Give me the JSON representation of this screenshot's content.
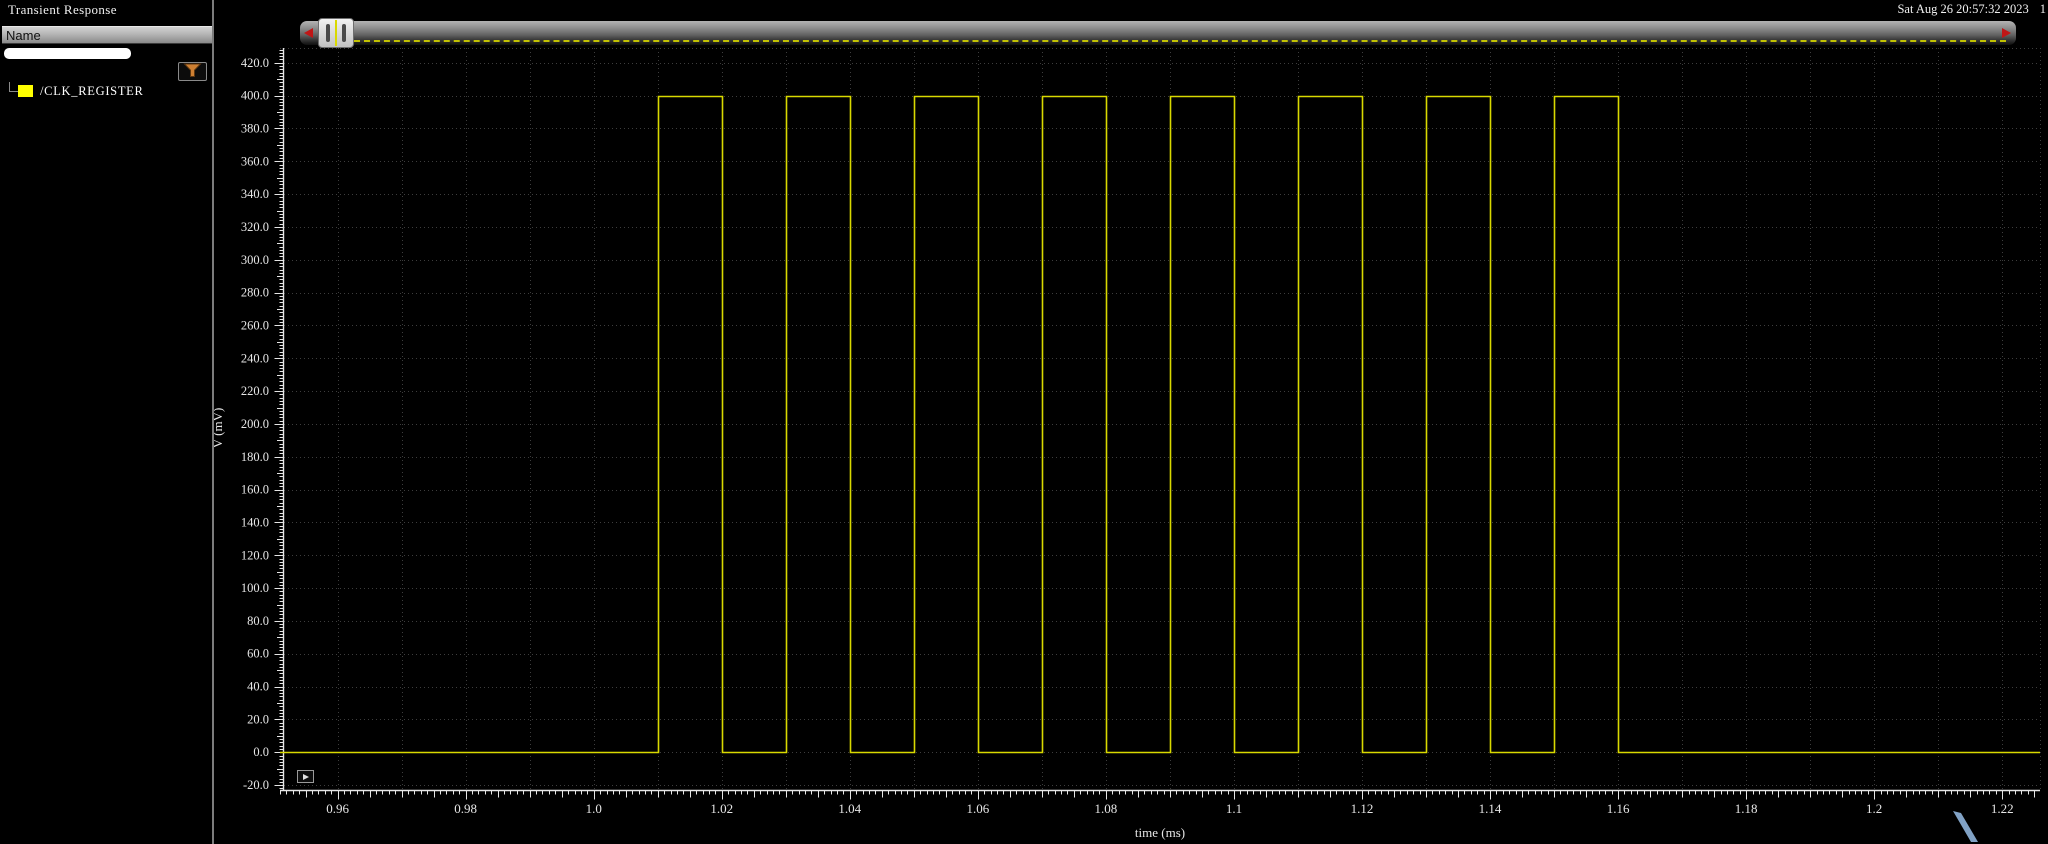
{
  "window": {
    "title": "Transient Response",
    "timestamp": "Sat Aug 26 20:57:32 2023",
    "window_number": "1"
  },
  "sidebar": {
    "column_header": "Name",
    "filter_value": "",
    "signals": [
      {
        "label": "/CLK_REGISTER",
        "color": "#ffff00"
      }
    ]
  },
  "icons": {
    "filter": "funnel-icon",
    "scroll_left": "triangle-left-icon",
    "scroll_right": "triangle-right-icon",
    "corner": "play-icon"
  },
  "colors": {
    "background": "#000000",
    "grid": "#3d3d3d",
    "axis": "#e6e6e6",
    "trace": "#d9d900",
    "legend_swatch": "#ffff00",
    "filter_accent": "#cd7f32",
    "scroll_arrow": "#c01616",
    "cursor": "#8fb4da"
  },
  "chart_data": {
    "type": "line",
    "title": "Transient Response",
    "xlabel": "time (ms)",
    "ylabel": "V (mV)",
    "xlim": [
      0.951,
      1.2259
    ],
    "ylim": [
      -23,
      429
    ],
    "grid": true,
    "x_axis": {
      "labeled_ticks": [
        {
          "t": 0.96,
          "label": "0.96"
        },
        {
          "t": 0.98,
          "label": "0.98"
        },
        {
          "t": 1.0,
          "label": "1.0"
        },
        {
          "t": 1.02,
          "label": "1.02"
        },
        {
          "t": 1.04,
          "label": "1.04"
        },
        {
          "t": 1.06,
          "label": "1.06"
        },
        {
          "t": 1.08,
          "label": "1.08"
        },
        {
          "t": 1.1,
          "label": "1.1"
        },
        {
          "t": 1.12,
          "label": "1.12"
        },
        {
          "t": 1.14,
          "label": "1.14"
        },
        {
          "t": 1.16,
          "label": "1.16"
        },
        {
          "t": 1.18,
          "label": "1.18"
        },
        {
          "t": 1.2,
          "label": "1.2"
        },
        {
          "t": 1.22,
          "label": "1.22"
        }
      ],
      "minor_step_ms": 0.001,
      "medium_step_ms": 0.005,
      "grid_step_ms": 0.01
    },
    "y_axis": {
      "label_min": -20,
      "label_max": 420,
      "label_step": 20,
      "minor_step": 2,
      "medium_step": 10,
      "decimals": 1
    },
    "series": [
      {
        "name": "/CLK_REGISTER",
        "color": "#d9d900",
        "unit": "mV",
        "low_value": 0.0,
        "high_value": 400.0,
        "t_start_ms": 0.951,
        "t_end_ms": 1.2259,
        "high_intervals_ms": [
          [
            1.01,
            1.02
          ],
          [
            1.03,
            1.04
          ],
          [
            1.05,
            1.06
          ],
          [
            1.07,
            1.08
          ],
          [
            1.09,
            1.1
          ],
          [
            1.11,
            1.12
          ],
          [
            1.13,
            1.14
          ],
          [
            1.15,
            1.16
          ]
        ]
      }
    ]
  }
}
